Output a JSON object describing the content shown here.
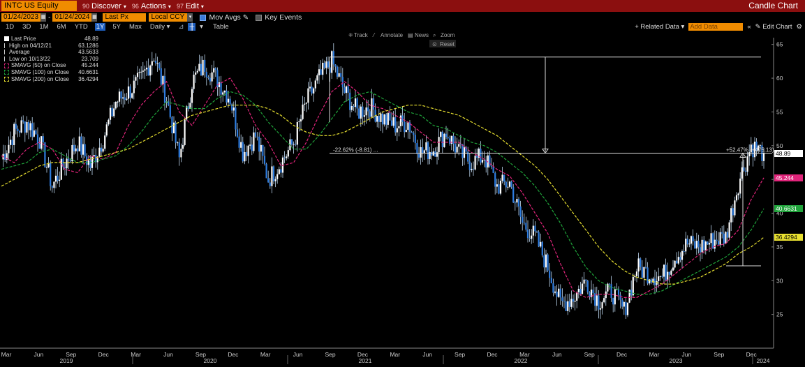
{
  "topbar": {
    "ticker": "INTC US Equity",
    "menus": [
      {
        "num": "90",
        "label": "Discover"
      },
      {
        "num": "96",
        "label": "Actions"
      },
      {
        "num": "97",
        "label": "Edit"
      }
    ],
    "window_title": "Candle Chart"
  },
  "toolbar2": {
    "start_date": "01/24/2023",
    "end_date": "01/24/2024",
    "price_field": "Last Px",
    "currency": "Local CCY",
    "mov_avgs_label": "Mov Avgs",
    "key_events_label": "Key Events"
  },
  "toolbar3": {
    "periods": [
      "1D",
      "3D",
      "1M",
      "6M",
      "YTD",
      "1Y",
      "5Y",
      "Max"
    ],
    "active_period": "1Y",
    "frequency": "Daily",
    "table_label": "Table",
    "related_data": "+ Related Data",
    "add_data_placeholder": "Add Data",
    "edit_chart": "Edit Chart"
  },
  "chart_tools": {
    "track": "Track",
    "annotate": "Annotate",
    "news": "News",
    "zoom": "Zoom",
    "reset": "Reset"
  },
  "legend": {
    "rows": [
      {
        "label": "Last Price",
        "value": "48.89",
        "color": "#ffffff"
      },
      {
        "label": "High on 04/12/21",
        "value": "63.1286",
        "color": "#cccccc"
      },
      {
        "label": "Average",
        "value": "43.5633",
        "color": "#cccccc"
      },
      {
        "label": "Low on 10/13/22",
        "value": "23.709",
        "color": "#cccccc"
      },
      {
        "label": "SMAVG (50)  on Close",
        "value": "45.244",
        "color": "#e0247a"
      },
      {
        "label": "SMAVG (100)  on Close",
        "value": "40.6631",
        "color": "#1fa33a"
      },
      {
        "label": "SMAVG (200)  on Close",
        "value": "36.4294",
        "color": "#e8e030"
      }
    ]
  },
  "price_tags": [
    {
      "value": "48.89",
      "bg": "#ffffff",
      "fg": "#000000"
    },
    {
      "value": "45.244",
      "bg": "#e0247a",
      "fg": "#ffffff"
    },
    {
      "value": "40.6631",
      "bg": "#1fa33a",
      "fg": "#ffffff"
    },
    {
      "value": "36.4294",
      "bg": "#e8e030",
      "fg": "#000000"
    }
  ],
  "annotations": {
    "drop_label": "-22.62% (-8.81) ...",
    "rise_label": "+52.47% (+475.13)"
  },
  "chart_data": {
    "type": "candlestick",
    "ylim": [
      20,
      66
    ],
    "yticks": [
      25,
      30,
      35,
      40,
      45,
      50,
      55,
      60,
      65
    ],
    "x_month_labels": [
      "Mar",
      "Jun",
      "Sep",
      "Dec",
      "Mar",
      "Jun",
      "Sep",
      "Dec",
      "Mar",
      "Jun",
      "Sep",
      "Dec",
      "Mar",
      "Jun",
      "Sep",
      "Dec",
      "Mar",
      "Jun",
      "Sep",
      "Dec",
      "Mar",
      "Jun",
      "Sep",
      "Dec"
    ],
    "x_year_labels": [
      "2019",
      "2020",
      "2021",
      "2022",
      "2023",
      "2024"
    ],
    "x_start": "2019-01",
    "x_end": "2024-01",
    "grid": false,
    "axis_side": "right",
    "price_monthly": [
      {
        "date": "2019-01",
        "close": 48.0
      },
      {
        "date": "2019-02",
        "close": 52.0
      },
      {
        "date": "2019-03",
        "close": 53.5
      },
      {
        "date": "2019-04",
        "close": 51.0
      },
      {
        "date": "2019-05",
        "close": 44.0
      },
      {
        "date": "2019-06",
        "close": 47.5
      },
      {
        "date": "2019-07",
        "close": 50.5
      },
      {
        "date": "2019-08",
        "close": 47.0
      },
      {
        "date": "2019-09",
        "close": 51.0
      },
      {
        "date": "2019-10",
        "close": 56.5
      },
      {
        "date": "2019-11",
        "close": 58.0
      },
      {
        "date": "2019-12",
        "close": 59.8
      },
      {
        "date": "2020-01",
        "close": 63.5
      },
      {
        "date": "2020-02",
        "close": 57.0
      },
      {
        "date": "2020-03",
        "close": 48.0
      },
      {
        "date": "2020-04",
        "close": 59.5
      },
      {
        "date": "2020-05",
        "close": 62.0
      },
      {
        "date": "2020-06",
        "close": 59.8
      },
      {
        "date": "2020-07",
        "close": 57.0
      },
      {
        "date": "2020-08",
        "close": 49.0
      },
      {
        "date": "2020-09",
        "close": 51.5
      },
      {
        "date": "2020-10",
        "close": 45.0
      },
      {
        "date": "2020-11",
        "close": 47.5
      },
      {
        "date": "2020-12",
        "close": 50.5
      },
      {
        "date": "2021-01",
        "close": 56.5
      },
      {
        "date": "2021-02",
        "close": 60.0
      },
      {
        "date": "2021-03",
        "close": 62.5
      },
      {
        "date": "2021-04",
        "close": 58.0
      },
      {
        "date": "2021-05",
        "close": 55.0
      },
      {
        "date": "2021-06",
        "close": 55.8
      },
      {
        "date": "2021-07",
        "close": 54.0
      },
      {
        "date": "2021-08",
        "close": 53.0
      },
      {
        "date": "2021-09",
        "close": 53.5
      },
      {
        "date": "2021-10",
        "close": 49.0
      },
      {
        "date": "2021-11",
        "close": 49.5
      },
      {
        "date": "2021-12",
        "close": 52.0
      },
      {
        "date": "2022-01",
        "close": 49.0
      },
      {
        "date": "2022-02",
        "close": 47.5
      },
      {
        "date": "2022-03",
        "close": 48.5
      },
      {
        "date": "2022-04",
        "close": 44.0
      },
      {
        "date": "2022-05",
        "close": 44.5
      },
      {
        "date": "2022-06",
        "close": 38.5
      },
      {
        "date": "2022-07",
        "close": 36.5
      },
      {
        "date": "2022-08",
        "close": 32.0
      },
      {
        "date": "2022-09",
        "close": 26.5
      },
      {
        "date": "2022-10",
        "close": 27.5
      },
      {
        "date": "2022-11",
        "close": 30.0
      },
      {
        "date": "2022-12",
        "close": 27.0
      },
      {
        "date": "2023-01",
        "close": 28.5
      },
      {
        "date": "2023-02",
        "close": 25.5
      },
      {
        "date": "2023-03",
        "close": 32.0
      },
      {
        "date": "2023-04",
        "close": 31.0
      },
      {
        "date": "2023-05",
        "close": 30.5
      },
      {
        "date": "2023-06",
        "close": 33.5
      },
      {
        "date": "2023-07",
        "close": 35.5
      },
      {
        "date": "2023-08",
        "close": 35.0
      },
      {
        "date": "2023-09",
        "close": 36.0
      },
      {
        "date": "2023-10",
        "close": 36.5
      },
      {
        "date": "2023-11",
        "close": 44.5
      },
      {
        "date": "2023-12",
        "close": 50.0
      },
      {
        "date": "2024-01",
        "close": 48.89
      }
    ],
    "series": [
      {
        "name": "SMAVG (50)  on Close",
        "color": "#e0247a",
        "values": [
          48.5,
          47.5,
          49.5,
          50.5,
          49.5,
          46.5,
          46.0,
          48.5,
          48.0,
          49.0,
          53.0,
          56.0,
          58.0,
          59.5,
          55.0,
          53.0,
          56.0,
          59.0,
          60.0,
          57.0,
          53.0,
          50.5,
          47.0,
          47.5,
          50.5,
          54.5,
          58.0,
          59.5,
          58.0,
          56.0,
          55.5,
          54.5,
          53.5,
          52.0,
          50.5,
          50.5,
          50.5,
          49.0,
          48.0,
          46.5,
          45.5,
          43.0,
          40.0,
          37.0,
          32.5,
          28.5,
          27.5,
          28.0,
          28.0,
          27.5,
          27.5,
          28.5,
          29.5,
          31.0,
          32.5,
          34.0,
          35.0,
          35.5,
          37.5,
          42.0,
          45.244
        ]
      },
      {
        "name": "SMAVG (100)  on Close",
        "color": "#1fa33a",
        "values": [
          46.5,
          47.0,
          47.5,
          49.0,
          49.5,
          48.5,
          47.5,
          47.5,
          48.0,
          48.5,
          50.0,
          52.0,
          54.5,
          56.5,
          56.0,
          55.5,
          55.5,
          57.0,
          58.0,
          57.5,
          56.0,
          53.5,
          51.5,
          49.5,
          49.5,
          51.5,
          54.0,
          56.5,
          57.5,
          58.0,
          57.0,
          56.0,
          55.0,
          54.5,
          53.0,
          52.5,
          51.5,
          50.5,
          50.0,
          49.0,
          47.5,
          46.0,
          44.0,
          41.5,
          38.5,
          35.0,
          32.0,
          30.0,
          29.0,
          28.5,
          28.0,
          28.0,
          28.5,
          29.5,
          30.5,
          31.5,
          32.5,
          33.5,
          35.0,
          37.5,
          40.6631
        ]
      },
      {
        "name": "SMAVG (200)  on Close",
        "color": "#e8e030",
        "values": [
          44.0,
          45.0,
          46.0,
          47.0,
          47.5,
          47.5,
          47.5,
          48.0,
          48.5,
          49.0,
          49.5,
          50.5,
          51.5,
          52.5,
          53.5,
          54.5,
          55.0,
          55.5,
          56.0,
          56.0,
          56.0,
          55.5,
          54.5,
          53.0,
          52.0,
          51.5,
          51.5,
          52.0,
          53.0,
          54.0,
          55.0,
          55.5,
          56.0,
          56.0,
          55.5,
          55.0,
          54.5,
          53.5,
          52.5,
          51.5,
          50.0,
          48.5,
          47.0,
          45.0,
          42.5,
          40.0,
          37.5,
          35.0,
          33.0,
          31.5,
          30.5,
          30.0,
          29.5,
          29.5,
          30.0,
          30.5,
          31.5,
          32.5,
          34.0,
          35.0,
          36.4294
        ]
      }
    ],
    "high": {
      "date": "2021-04-12",
      "value": 63.1286
    },
    "low": {
      "date": "2022-10-13",
      "value": 23.709
    },
    "average": 43.5633
  }
}
